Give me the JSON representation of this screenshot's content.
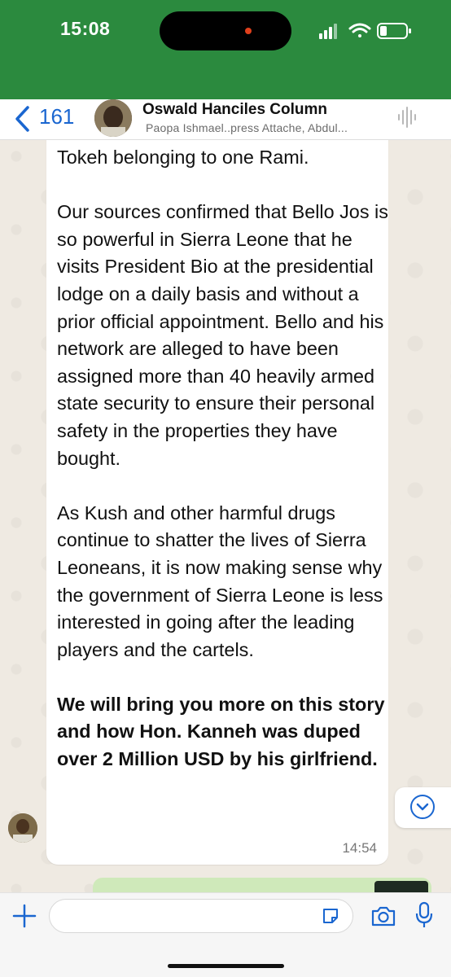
{
  "status_bar": {
    "time": "15:08",
    "icons": [
      "signal-icon",
      "wifi-icon",
      "battery-icon"
    ],
    "background_color": "#2b8a3e"
  },
  "header": {
    "back_count": "161",
    "title": "Oswald Hanciles Column",
    "subtitle": "Paopa Ishmael..press Attache, Abdul...",
    "icons": [
      "chevron-left-icon",
      "avatar",
      "voice-waveform-icon"
    ],
    "accent_color": "#1a66d0"
  },
  "message": {
    "paragraphs": [
      "Tokeh belonging to one Rami.",
      "Our sources confirmed that Bello Jos is so powerful in Sierra Leone that he visits  President Bio at the presidential lodge on a daily basis and without a prior official appointment. Bello and his network are alleged to have been assigned more than 40 heavily armed state security to ensure their personal safety in the properties they have bought.",
      "As Kush and other harmful drugs continue to shatter the lives of Sierra Leoneans, it is now making sense why the government of Sierra Leone is less interested in going after the leading players and the cartels."
    ],
    "bold_paragraph": "We will bring you more on this story and how Hon. Kanneh was duped over 2 Million USD by his girlfriend.",
    "time": "14:54"
  },
  "input_bar": {
    "text_value": "",
    "icons": [
      "plus-icon",
      "sticker-icon",
      "camera-icon",
      "microphone-icon"
    ]
  }
}
